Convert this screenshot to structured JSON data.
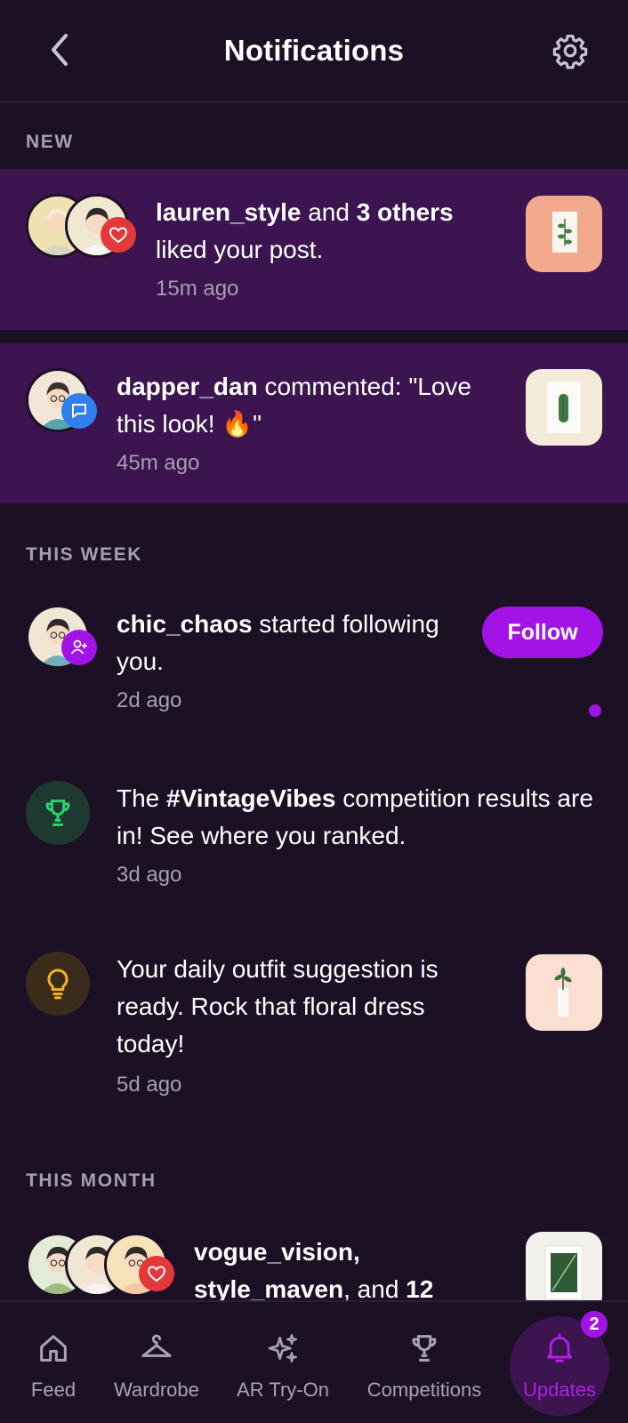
{
  "header": {
    "title": "Notifications",
    "back_icon": "chevron-left-icon",
    "settings_icon": "gear-icon"
  },
  "sections": {
    "new": "NEW",
    "this_week": "THIS WEEK",
    "this_month": "THIS MONTH"
  },
  "notifications": [
    {
      "user": "lauren_style",
      "middle": " and ",
      "others": "3 others",
      "text": "liked your post.",
      "time": "15m ago",
      "badge": "heart-icon"
    },
    {
      "user": "dapper_dan",
      "text": " commented: \"Love this look! 🔥\"",
      "time": "45m ago",
      "badge": "comment-icon"
    },
    {
      "user": "chic_chaos",
      "text": " started following you.",
      "time": "2d ago",
      "badge": "user-plus-icon",
      "action": "Follow"
    },
    {
      "pre": "The ",
      "tag": "#VintageVibes",
      "text": " competition results are in! See where you ranked.",
      "time": "3d ago",
      "icon": "trophy-icon"
    },
    {
      "text": "Your daily outfit suggestion is ready. Rock that floral dress today!",
      "time": "5d ago",
      "icon": "lightbulb-icon"
    },
    {
      "user": "vogue_vision,",
      "user2": "style_maven",
      "middle": ", and ",
      "others": "12",
      "badge": "heart-icon"
    }
  ],
  "nav": [
    {
      "label": "Feed",
      "icon": "home-icon"
    },
    {
      "label": "Wardrobe",
      "icon": "hanger-icon"
    },
    {
      "label": "AR Try-On",
      "icon": "sparkles-icon"
    },
    {
      "label": "Competitions",
      "icon": "trophy-icon"
    },
    {
      "label": "Updates",
      "icon": "bell-icon",
      "badge": "2",
      "active": true
    }
  ],
  "colors": {
    "background": "#1c1124",
    "highlight": "#3b1450",
    "accent": "#a313e8",
    "heart": "#e5383b",
    "comment": "#2f80ed"
  }
}
